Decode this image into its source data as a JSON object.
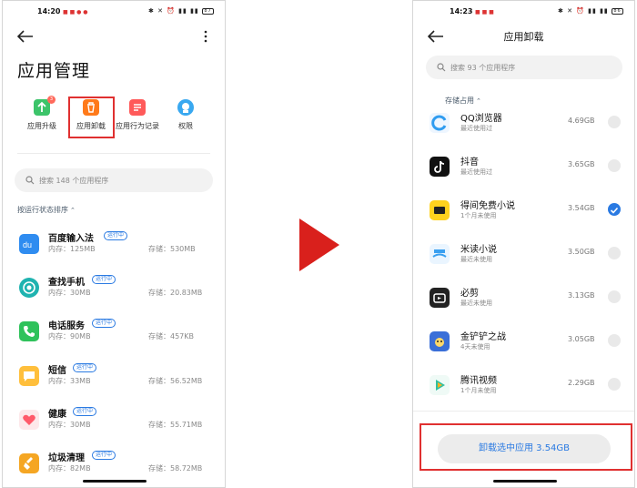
{
  "left_screen": {
    "status_bar": {
      "time": "14:20",
      "battery": "87"
    },
    "title": "应用管理",
    "tools": [
      {
        "label": "应用升级",
        "icon": "upgrade-icon",
        "color": "#3cc46a",
        "badge": "3"
      },
      {
        "label": "应用卸载",
        "icon": "trash-icon",
        "color": "#ff7a1a"
      },
      {
        "label": "应用行为记录",
        "icon": "record-icon",
        "color": "#ff5a5a"
      },
      {
        "label": "权限",
        "icon": "permission-icon",
        "color": "#39a8f0"
      }
    ],
    "search_placeholder": "搜索 148 个应用程序",
    "sort_label": "按运行状态排序",
    "apps": [
      {
        "name": "百度输入法",
        "status": "运行中",
        "memory": "内存：125MB",
        "storage": "存储：530MB",
        "icon": "baidu-input-icon",
        "color": "#2f8cf0"
      },
      {
        "name": "查找手机",
        "status": "运行中",
        "memory": "内存：30MB",
        "storage": "存储：20.83MB",
        "icon": "find-phone-icon",
        "color": "#1fb3b0"
      },
      {
        "name": "电话服务",
        "status": "运行中",
        "memory": "内存：90MB",
        "storage": "存储：457KB",
        "icon": "phone-icon",
        "color": "#2fc25b"
      },
      {
        "name": "短信",
        "status": "运行中",
        "memory": "内存：33MB",
        "storage": "存储：56.52MB",
        "icon": "sms-icon",
        "color": "#ffbf3c"
      },
      {
        "name": "健康",
        "status": "运行中",
        "memory": "内存：30MB",
        "storage": "存储：55.71MB",
        "icon": "health-icon",
        "color": "#ff5a6a"
      },
      {
        "name": "垃圾清理",
        "status": "运行中",
        "memory": "内存：82MB",
        "storage": "存储：58.72MB",
        "icon": "cleaner-icon",
        "color": "#f5a623"
      }
    ]
  },
  "right_screen": {
    "status_bar": {
      "time": "14:23",
      "battery": "86"
    },
    "title": "应用卸载",
    "search_placeholder": "搜索 93 个应用程序",
    "sort_label": "存储占用",
    "apps": [
      {
        "name": "QQ浏览器",
        "sub": "最近使用过",
        "size": "4.69GB",
        "checked": false,
        "icon": "qq-browser-icon",
        "color": "#2f9cf0"
      },
      {
        "name": "抖音",
        "sub": "最近使用过",
        "size": "3.65GB",
        "checked": false,
        "icon": "douyin-icon",
        "color": "#111111"
      },
      {
        "name": "得间免费小说",
        "sub": "1个月未使用",
        "size": "3.54GB",
        "checked": true,
        "icon": "dejian-novel-icon",
        "color": "#ffd21e"
      },
      {
        "name": "米读小说",
        "sub": "最近未使用",
        "size": "3.50GB",
        "checked": false,
        "icon": "midu-novel-icon",
        "color": "#3aa0f0"
      },
      {
        "name": "必剪",
        "sub": "最近未使用",
        "size": "3.13GB",
        "checked": false,
        "icon": "bijian-icon",
        "color": "#222222"
      },
      {
        "name": "金铲铲之战",
        "sub": "4天未使用",
        "size": "3.05GB",
        "checked": false,
        "icon": "golden-spatula-icon",
        "color": "#3a6fd8"
      },
      {
        "name": "腾讯视频",
        "sub": "1个月未使用",
        "size": "2.29GB",
        "checked": false,
        "icon": "tencent-video-icon",
        "color": "#2fc0a0"
      }
    ],
    "uninstall_button": "卸载选中应用 3.54GB"
  },
  "colors": {
    "accent": "#2a7ae2",
    "highlight_red": "#e03030",
    "arrow_red": "#d9201c"
  }
}
